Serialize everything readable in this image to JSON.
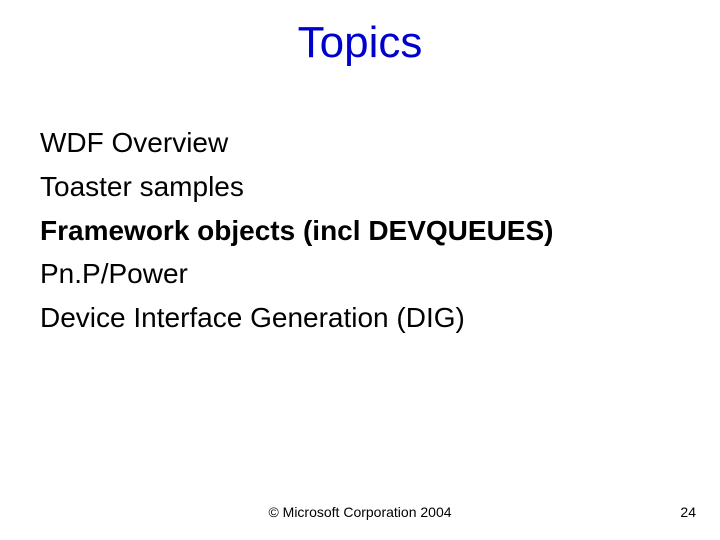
{
  "title": "Topics",
  "items": [
    {
      "text": "WDF Overview",
      "highlight": false
    },
    {
      "text": "Toaster samples",
      "highlight": false
    },
    {
      "text": "Framework objects (incl DEVQUEUES)",
      "highlight": true
    },
    {
      "text": "Pn.P/Power",
      "highlight": false
    },
    {
      "text": "Device Interface Generation (DIG)",
      "highlight": false
    }
  ],
  "footer": "© Microsoft Corporation 2004",
  "page": "24"
}
